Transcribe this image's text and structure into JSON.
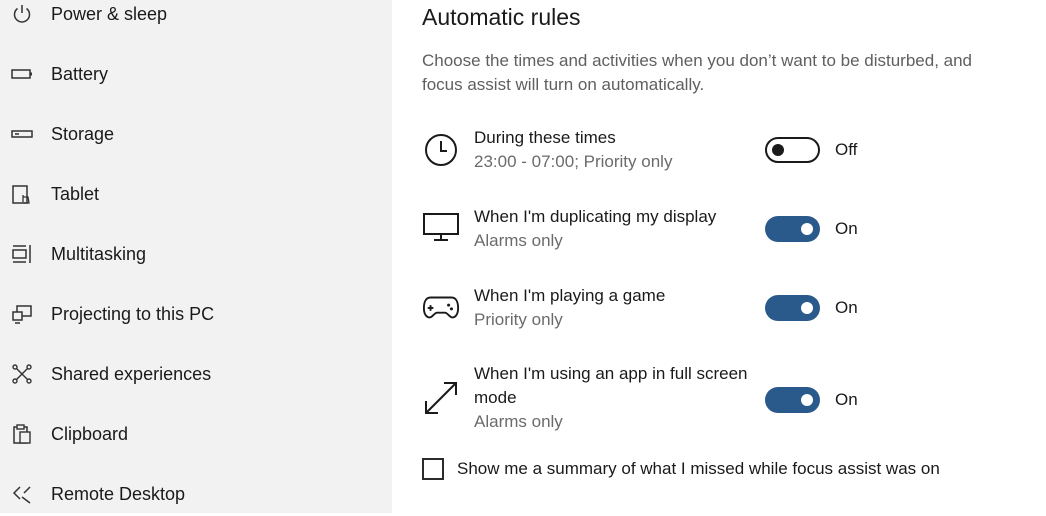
{
  "sidebar": {
    "items": [
      {
        "label": "Power & sleep",
        "icon": "power-icon"
      },
      {
        "label": "Battery",
        "icon": "battery-icon"
      },
      {
        "label": "Storage",
        "icon": "storage-icon"
      },
      {
        "label": "Tablet",
        "icon": "tablet-icon"
      },
      {
        "label": "Multitasking",
        "icon": "multitasking-icon"
      },
      {
        "label": "Projecting to this PC",
        "icon": "projecting-icon"
      },
      {
        "label": "Shared experiences",
        "icon": "shared-experiences-icon"
      },
      {
        "label": "Clipboard",
        "icon": "clipboard-icon"
      },
      {
        "label": "Remote Desktop",
        "icon": "remote-desktop-icon"
      }
    ]
  },
  "main": {
    "title": "Automatic rules",
    "description": "Choose the times and activities when you don’t want to be disturbed, and focus assist will turn on automatically.",
    "rules": [
      {
        "title": "During these times",
        "subtitle": "23:00 - 07:00; Priority only",
        "state": "Off",
        "icon": "clock-icon"
      },
      {
        "title": "When I'm duplicating my display",
        "subtitle": "Alarms only",
        "state": "On",
        "icon": "monitor-icon"
      },
      {
        "title": "When I'm playing a game",
        "subtitle": "Priority only",
        "state": "On",
        "icon": "gamepad-icon"
      },
      {
        "title": "When I'm using an app in full screen mode",
        "subtitle": "Alarms only",
        "state": "On",
        "icon": "fullscreen-icon"
      }
    ],
    "summary_checkbox": {
      "label": "Show me a summary of what I missed while focus assist was on",
      "checked": false
    }
  },
  "colors": {
    "toggle_on": "#2a5a8c",
    "sidebar_bg": "#f2f2f2"
  }
}
